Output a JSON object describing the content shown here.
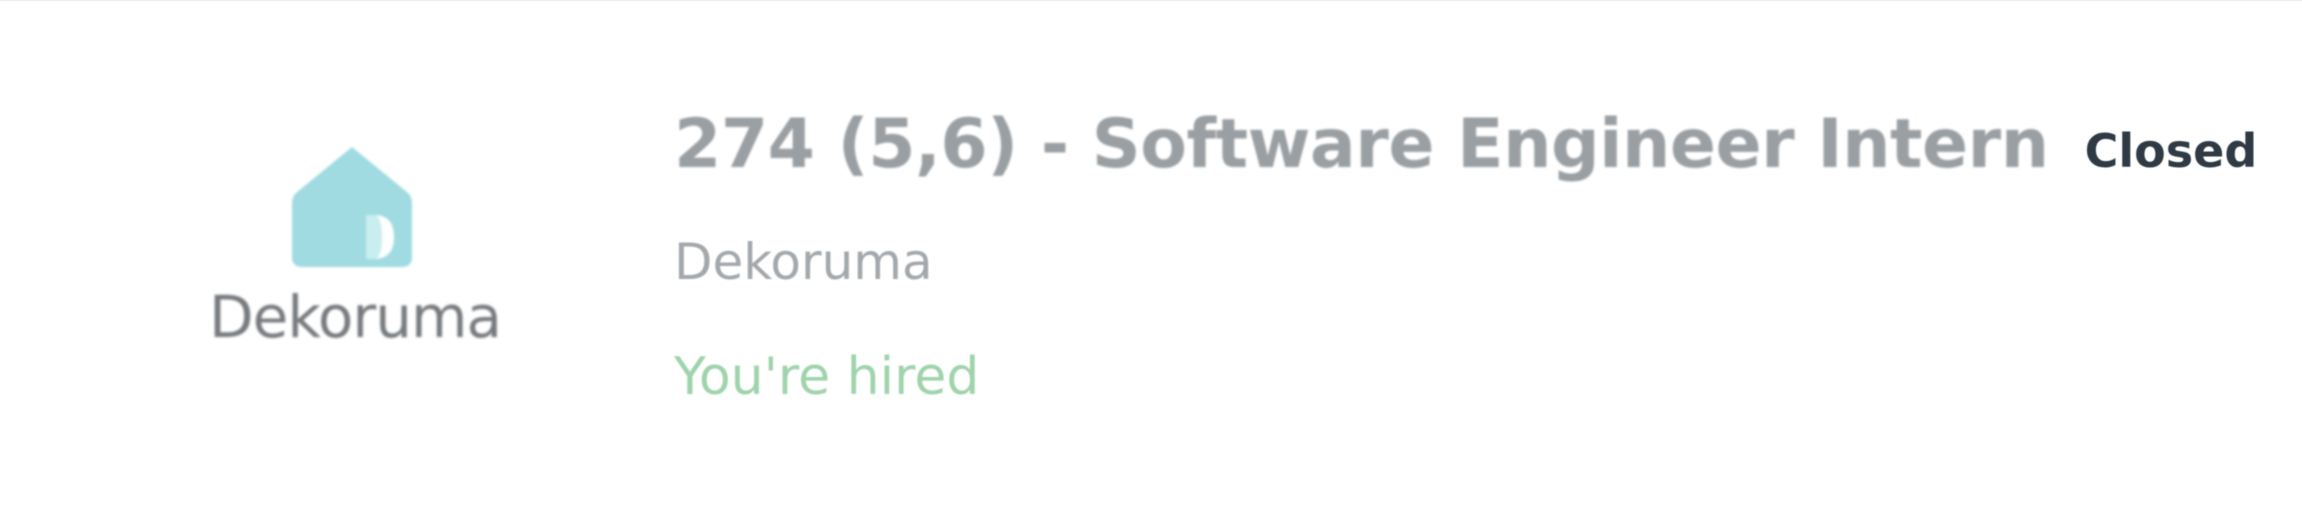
{
  "job": {
    "title": "274 (5,6) - Software Engineer Intern",
    "status": "Closed",
    "company": "Dekoruma",
    "result": "You're hired"
  },
  "logo": {
    "text": "Dekoruma",
    "icon": "house-icon",
    "house_color": "#9fdbe0",
    "text_color": "#777b7f"
  },
  "colors": {
    "title": "#9a9fa3",
    "status": "#2f3a44",
    "company": "#a3a8ac",
    "hired": "#9fd3ab"
  }
}
